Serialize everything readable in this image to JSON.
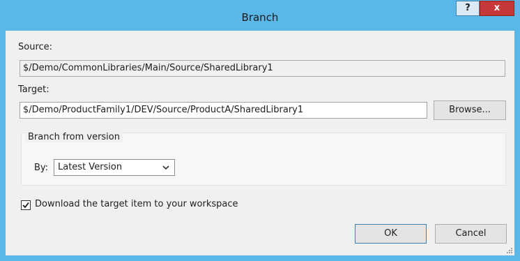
{
  "window": {
    "title": "Branch",
    "help_label": "?",
    "close_label": "x"
  },
  "source": {
    "label": "Source:",
    "value": "$/Demo/CommonLibraries/Main/Source/SharedLibrary1"
  },
  "target": {
    "label": "Target:",
    "value": "$/Demo/ProductFamily1/DEV/Source/ProductA/SharedLibrary1",
    "browse_label": "Browse..."
  },
  "branch_from": {
    "legend": "Branch from version",
    "by_label": "By:",
    "selected": "Latest Version"
  },
  "download": {
    "label": "Download the target item to your workspace",
    "checked": true
  },
  "buttons": {
    "ok": "OK",
    "cancel": "Cancel"
  },
  "colors": {
    "titlebar": "#5bb7e8",
    "close": "#c7383b",
    "client": "#f0f0f0",
    "default_button_border": "#3c7fb1"
  },
  "icons": {
    "checkbox_mark": "checkmark-icon",
    "dropdown": "chevron-down-icon",
    "resize": "resize-grip-icon"
  }
}
